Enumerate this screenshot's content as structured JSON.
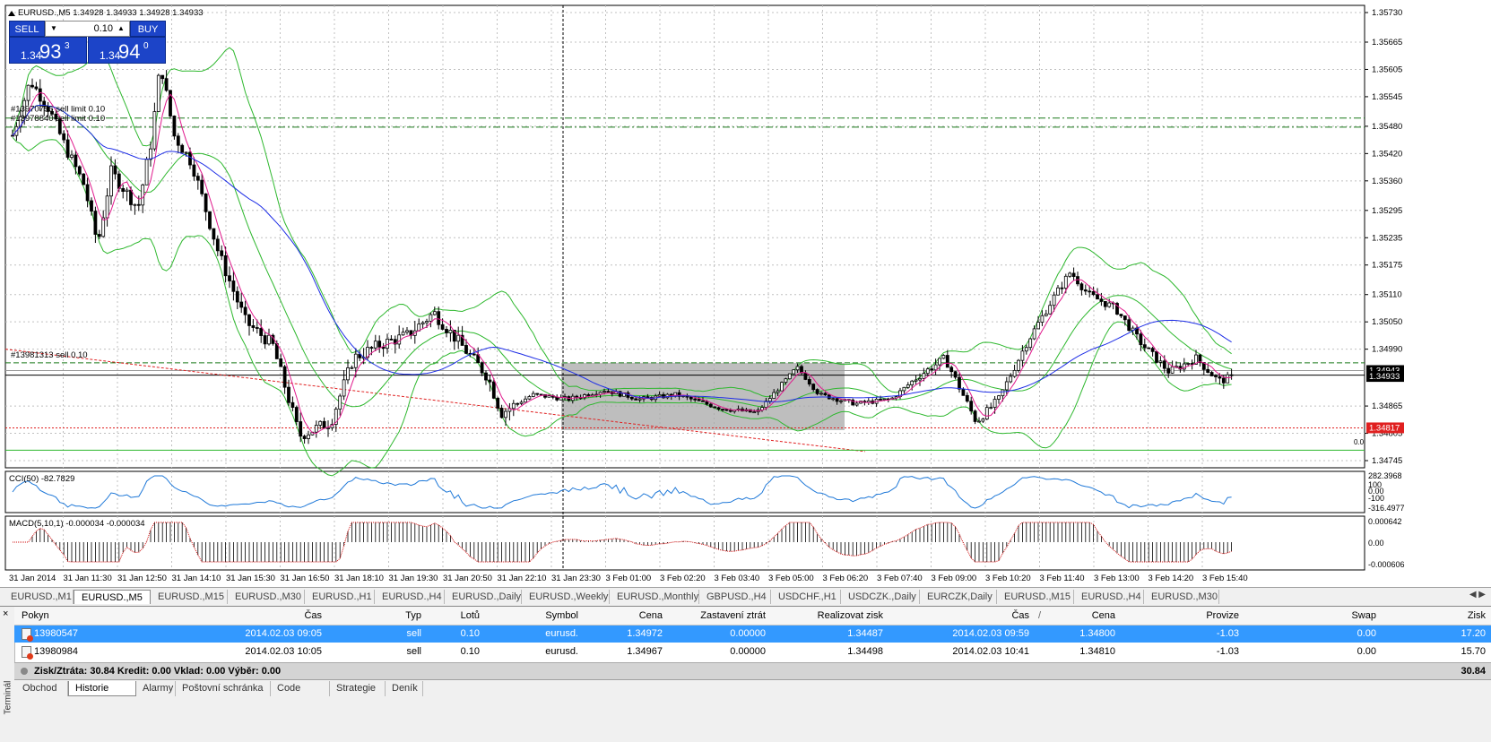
{
  "chart": {
    "header": "EURUSD.,M5  1.34928 1.34933 1.34928 1.34933",
    "cci_label": "CCI(50) -82.7829",
    "macd_label": "MACD(5,10,1) -0.000034 -0.000034",
    "order_labels": [
      "#13970756 sell limit 0.10",
      "#13978840 sell limit 0.10",
      "#13981313 sell 0.10"
    ],
    "zero_label": "0.0",
    "price_axis": [
      "1.35730",
      "1.35665",
      "1.35605",
      "1.35545",
      "1.35480",
      "1.35420",
      "1.35360",
      "1.35295",
      "1.35235",
      "1.35175",
      "1.35110",
      "1.35050",
      "1.34990",
      "1.34865",
      "1.34805",
      "1.34745"
    ],
    "current_bid": "1.34933",
    "current_ask": "1.34943",
    "red_level": "1.34817",
    "cci_axis": [
      "282.3968",
      "100",
      "0.00",
      "-100",
      "-316.4977"
    ],
    "macd_axis": [
      "0.000642",
      "0.00",
      "-0.000606"
    ],
    "time_axis": [
      "31 Jan 2014",
      "31 Jan 11:30",
      "31 Jan 12:50",
      "31 Jan 14:10",
      "31 Jan 15:30",
      "31 Jan 16:50",
      "31 Jan 18:10",
      "31 Jan 19:30",
      "31 Jan 20:50",
      "31 Jan 22:10",
      "31 Jan 23:30",
      "3 Feb 01:00",
      "3 Feb 02:20",
      "3 Feb 03:40",
      "3 Feb 05:00",
      "3 Feb 06:20",
      "3 Feb 07:40",
      "3 Feb 09:00",
      "3 Feb 10:20",
      "3 Feb 11:40",
      "3 Feb 13:00",
      "3 Feb 14:20",
      "3 Feb 15:40"
    ],
    "colors": {
      "bull": "#ffffff",
      "bear": "#000000",
      "bands": "#2eb82e",
      "ma_fast": "#e0198c",
      "ma_slow": "#1e2ee6",
      "cci": "#1e78d8",
      "macd": "#d01010",
      "grid": "#c0c0c0",
      "order": "#1a7a1a"
    }
  },
  "trade_panel": {
    "sell_label": "SELL",
    "buy_label": "BUY",
    "lot": "0.10",
    "sell_small": "1.34",
    "sell_big": "93",
    "sell_sup": "3",
    "buy_small": "1.34",
    "buy_big": "94",
    "buy_sup": "0"
  },
  "chart_tabs": [
    {
      "label": "EURUSD.,M1",
      "active": false
    },
    {
      "label": "EURUSD.,M5",
      "active": true
    },
    {
      "label": "EURUSD.,M15",
      "active": false
    },
    {
      "label": "EURUSD.,M30",
      "active": false
    },
    {
      "label": "EURUSD.,H1",
      "active": false
    },
    {
      "label": "EURUSD.,H4",
      "active": false
    },
    {
      "label": "EURUSD.,Daily",
      "active": false
    },
    {
      "label": "EURUSD.,Weekly",
      "active": false
    },
    {
      "label": "EURUSD.,Monthly",
      "active": false
    },
    {
      "label": "GBPUSD.,H4",
      "active": false
    },
    {
      "label": "USDCHF.,H1",
      "active": false
    },
    {
      "label": "USDCZK.,Daily",
      "active": false
    },
    {
      "label": "EURCZK,Daily",
      "active": false
    },
    {
      "label": "EURUSD.,M15",
      "active": false
    },
    {
      "label": "EURUSD.,H4",
      "active": false
    },
    {
      "label": "EURUSD.,M30",
      "active": false
    }
  ],
  "terminal": {
    "side_label": "Terminál",
    "close": "×",
    "columns": [
      "Pokyn",
      "Čas",
      "Typ",
      "Lotů",
      "Symbol",
      "Cena",
      "Zastavení ztrát",
      "Realizovat zisk",
      "Čas",
      "/",
      "Cena",
      "Provize",
      "Swap",
      "Zisk"
    ],
    "rows": [
      {
        "order": "13980547",
        "open_time": "2014.02.03 09:05",
        "type": "sell",
        "lots": "0.10",
        "symbol": "eurusd.",
        "open_price": "1.34972",
        "sl": "0.00000",
        "tp": "1.34487",
        "close_time": "2014.02.03 09:59",
        "close_price": "1.34800",
        "commission": "-1.03",
        "swap": "0.00",
        "profit": "17.20",
        "selected": true
      },
      {
        "order": "13980984",
        "open_time": "2014.02.03 10:05",
        "type": "sell",
        "lots": "0.10",
        "symbol": "eurusd.",
        "open_price": "1.34967",
        "sl": "0.00000",
        "tp": "1.34498",
        "close_time": "2014.02.03 10:41",
        "close_price": "1.34810",
        "commission": "-1.03",
        "swap": "0.00",
        "profit": "15.70",
        "selected": false
      }
    ],
    "summary": "Zisk/Ztráta: 30.84  Kredit: 0.00  Vklad: 0.00  Výběr: 0.00",
    "summary_total": "30.84",
    "tabs": [
      {
        "label": "Obchod",
        "active": false
      },
      {
        "label": "Historie účtu",
        "active": true
      },
      {
        "label": "Alarmy",
        "active": false
      },
      {
        "label": "Poštovní schránka",
        "active": false
      },
      {
        "label": "Code Base",
        "active": false
      },
      {
        "label": "Strategie",
        "active": false
      },
      {
        "label": "Deník",
        "active": false
      }
    ]
  }
}
